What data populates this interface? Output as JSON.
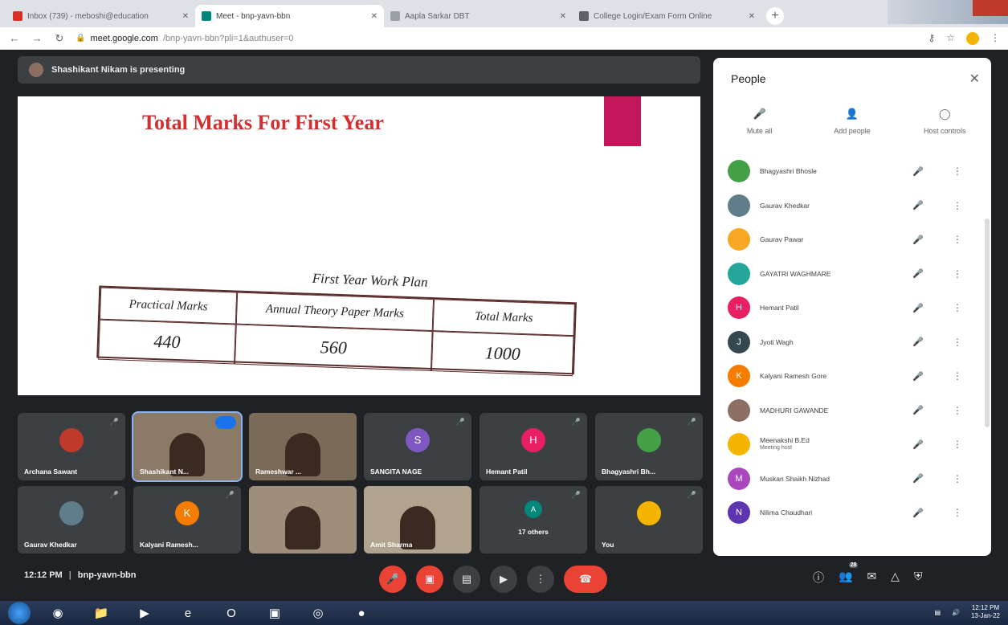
{
  "browser": {
    "tabs": [
      {
        "label": "Inbox (739) - meboshi@education",
        "color": "#d93025",
        "active": false
      },
      {
        "label": "Meet - bnp-yavn-bbn",
        "color": "#00897b",
        "active": true
      },
      {
        "label": "Aapla Sarkar DBT",
        "color": "#9aa0a6",
        "active": false
      },
      {
        "label": "College Login/Exam Form Online",
        "color": "#5f6368",
        "active": false
      }
    ],
    "url_host": "meet.google.com",
    "url_path": "/bnp-yavn-bbn?pli=1&authuser=0"
  },
  "presenting_text": "Shashikant Nikam is presenting",
  "slide": {
    "title": "Total Marks For First Year",
    "scan_heading": "First Year Work Plan",
    "headers": [
      "Practical Marks",
      "Annual Theory Paper Marks",
      "Total Marks"
    ],
    "values": [
      "440",
      "560",
      "1000"
    ]
  },
  "tiles": [
    {
      "name": "Archana Sawant",
      "initial": "",
      "color": "#c0392b",
      "kind": "photo"
    },
    {
      "name": "Shashikant N...",
      "initial": "",
      "color": "#8a7a66",
      "kind": "video",
      "active": true
    },
    {
      "name": "Rameshwar ...",
      "initial": "",
      "color": "#7a6a58",
      "kind": "video"
    },
    {
      "name": "SANGITA NAGE",
      "initial": "S",
      "color": "#7e57c2",
      "kind": "letter"
    },
    {
      "name": "Hemant Patil",
      "initial": "H",
      "color": "#e91e63",
      "kind": "letter"
    },
    {
      "name": "Bhagyashri Bh...",
      "initial": "",
      "color": "#43a047",
      "kind": "photo"
    },
    {
      "name": "Gaurav Khedkar",
      "initial": "",
      "color": "#607d8b",
      "kind": "photo"
    },
    {
      "name": "Kalyani Ramesh...",
      "initial": "K",
      "color": "#f57c00",
      "kind": "letter"
    },
    {
      "name": "",
      "initial": "",
      "color": "#9e8e7a",
      "kind": "video"
    },
    {
      "name": "Amit Sharma",
      "initial": "",
      "color": "#b0a48e",
      "kind": "video"
    },
    {
      "name": "17 others",
      "initial": "A",
      "color": "#00897b",
      "kind": "others"
    },
    {
      "name": "You",
      "initial": "",
      "color": "#f4b400",
      "kind": "photo"
    }
  ],
  "meeting": {
    "time": "12:12 PM",
    "code": "bnp-yavn-bbn"
  },
  "participants_count": "28",
  "panel": {
    "title": "People",
    "actions": [
      "Mute all",
      "Add people",
      "Host controls"
    ],
    "people": [
      {
        "name": "Bhagyashri Bhosle",
        "sub": "",
        "initial": "",
        "color": "#43a047"
      },
      {
        "name": "Gaurav Khedkar",
        "sub": "",
        "initial": "",
        "color": "#607d8b"
      },
      {
        "name": "Gaurav Pawar",
        "sub": "",
        "initial": "",
        "color": "#f9a825"
      },
      {
        "name": "GAYATRI WAGHMARE",
        "sub": "",
        "initial": "",
        "color": "#26a69a"
      },
      {
        "name": "Hemant Patil",
        "sub": "",
        "initial": "H",
        "color": "#e91e63"
      },
      {
        "name": "Jyoti Wagh",
        "sub": "",
        "initial": "J",
        "color": "#37474f"
      },
      {
        "name": "Kalyani Ramesh Gore",
        "sub": "",
        "initial": "K",
        "color": "#f57c00"
      },
      {
        "name": "MADHURI GAWANDE",
        "sub": "",
        "initial": "",
        "color": "#8d6e63"
      },
      {
        "name": "Meenakshi B.Ed",
        "sub": "Meeting host",
        "initial": "",
        "color": "#f4b400"
      },
      {
        "name": "Muskan Shaikh Nizhad",
        "sub": "",
        "initial": "M",
        "color": "#ab47bc"
      },
      {
        "name": "Nilima Chaudhari",
        "sub": "",
        "initial": "N",
        "color": "#5e35b1"
      }
    ]
  },
  "taskbar": {
    "time": "12:12 PM",
    "date": "13-Jan-22"
  }
}
